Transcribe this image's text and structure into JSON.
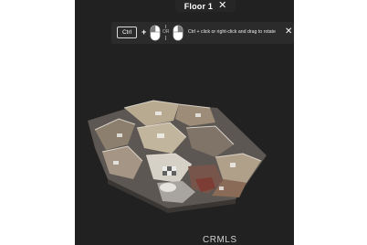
{
  "floor_selector": {
    "label": "Floor 1"
  },
  "hint": {
    "key_label": "Ctrl",
    "plus": "+",
    "or_label": "OR",
    "text": "Ctrl + click or right-click and drag to rotate"
  },
  "icons": {
    "close": "close-icon",
    "mouse_left": "mouse-left-click-icon",
    "mouse_right": "mouse-right-click-icon"
  },
  "watermark": "CRMLS",
  "colors": {
    "viewer_bg": "#212121",
    "hint_bg": "#2b2b2b",
    "page_bg": "#ffffff"
  }
}
